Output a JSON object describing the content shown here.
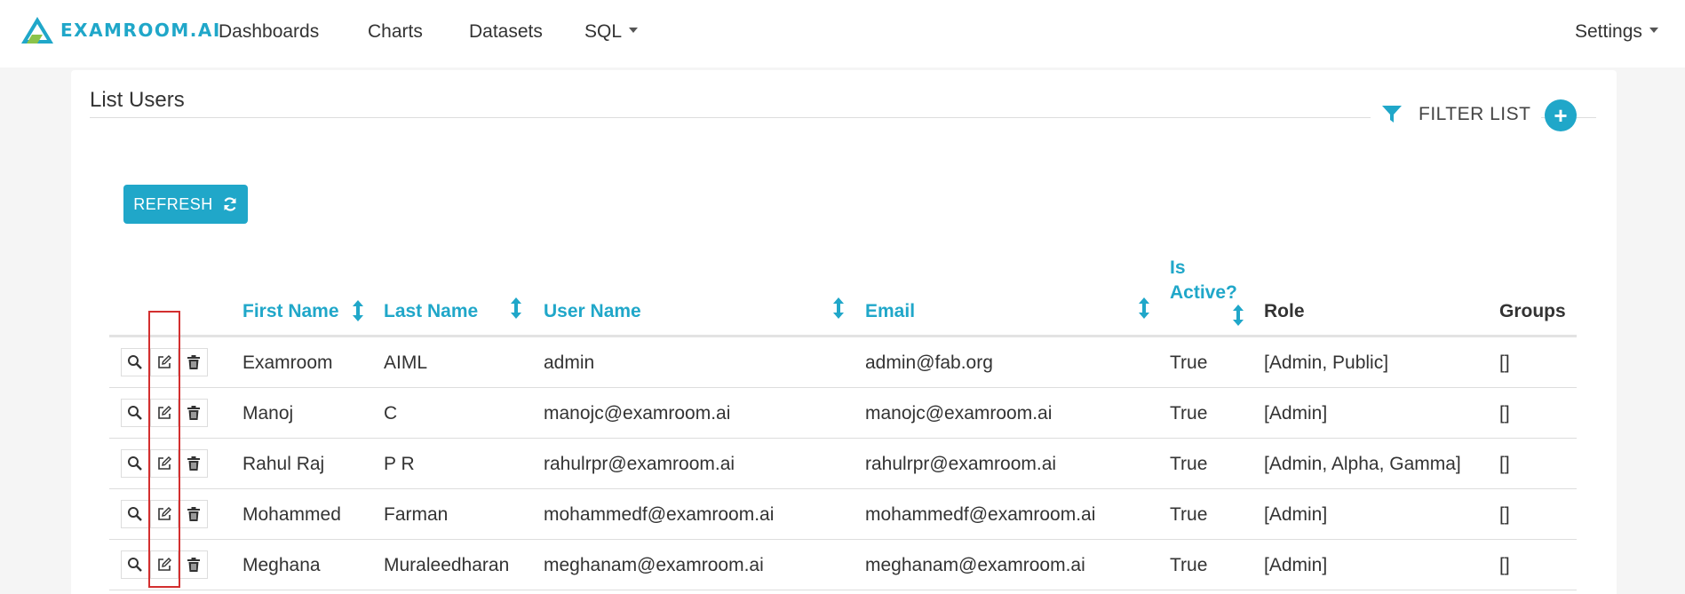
{
  "brand": {
    "name": "EXAMROOM.AI",
    "accent_color": "#20a7c9"
  },
  "navbar": {
    "items": [
      "Dashboards",
      "Charts",
      "Datasets",
      "SQL"
    ],
    "settings": "Settings"
  },
  "page": {
    "title": "List Users",
    "filter_label": "FILTER LIST",
    "add_label": "+",
    "refresh_label": "REFRESH"
  },
  "table": {
    "columns": {
      "first_name": "First Name",
      "last_name": "Last Name",
      "user_name": "User Name",
      "email": "Email",
      "is_active_1": "Is",
      "is_active_2": "Active?",
      "role": "Role",
      "groups": "Groups"
    },
    "rows": [
      {
        "first_name": "Examroom",
        "last_name": "AIML",
        "user_name": "admin",
        "email": "admin@fab.org",
        "active": "True",
        "role": "[Admin, Public]",
        "groups": "[]"
      },
      {
        "first_name": "Manoj",
        "last_name": "C",
        "user_name": "manojc@examroom.ai",
        "email": "manojc@examroom.ai",
        "active": "True",
        "role": "[Admin]",
        "groups": "[]"
      },
      {
        "first_name": "Rahul Raj",
        "last_name": "P R",
        "user_name": "rahulrpr@examroom.ai",
        "email": "rahulrpr@examroom.ai",
        "active": "True",
        "role": "[Admin, Alpha, Gamma]",
        "groups": "[]"
      },
      {
        "first_name": "Mohammed",
        "last_name": "Farman",
        "user_name": "mohammedf@examroom.ai",
        "email": "mohammedf@examroom.ai",
        "active": "True",
        "role": "[Admin]",
        "groups": "[]"
      },
      {
        "first_name": "Meghana",
        "last_name": "Muraleedharan",
        "user_name": "meghanam@examroom.ai",
        "email": "meghanam@examroom.ai",
        "active": "True",
        "role": "[Admin]",
        "groups": "[]"
      }
    ]
  },
  "icons": {
    "view": "search-icon",
    "edit": "edit-icon",
    "delete": "trash-icon",
    "filter": "filter-icon",
    "refresh": "refresh-icon",
    "sort": "sort-icon"
  }
}
